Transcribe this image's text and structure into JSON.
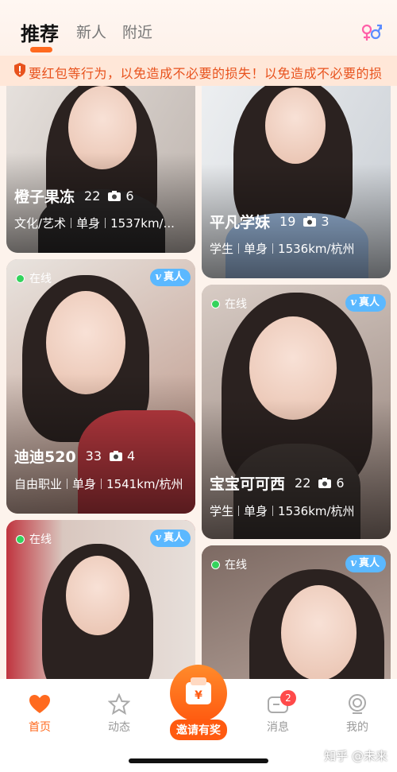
{
  "tabs": [
    {
      "label": "推荐"
    },
    {
      "label": "新人"
    },
    {
      "label": "附近"
    }
  ],
  "notice": {
    "text": "要红包等行为，以免造成不必要的损失！以免造成不必要的损"
  },
  "cards": [
    {
      "name": "橙子果冻",
      "age": "22",
      "photos": "6",
      "info": [
        "文化/艺术",
        "单身",
        "1537km/..."
      ],
      "online": "",
      "verified": ""
    },
    {
      "name": "平凡学妹",
      "age": "19",
      "photos": "3",
      "info": [
        "学生",
        "单身",
        "1536km/杭州"
      ],
      "online": "",
      "verified": ""
    },
    {
      "name": "迪迪520",
      "age": "33",
      "photos": "4",
      "info": [
        "自由职业",
        "单身",
        "1541km/杭州"
      ],
      "online": "在线",
      "verified": "真人"
    },
    {
      "name": "宝宝可可西",
      "age": "22",
      "photos": "6",
      "info": [
        "学生",
        "单身",
        "1536km/杭州"
      ],
      "online": "在线",
      "verified": "真人"
    },
    {
      "name": "",
      "age": "",
      "photos": "",
      "info": [],
      "online": "在线",
      "verified": "真人"
    },
    {
      "name": "",
      "age": "",
      "photos": "",
      "info": [],
      "online": "在线",
      "verified": "真人"
    }
  ],
  "nav": {
    "home": "首页",
    "moments": "动态",
    "invite": "邀请有奖",
    "messages": "消息",
    "messages_badge": "2",
    "me": "我的"
  },
  "watermark": "知乎 @未来",
  "colors": {
    "accent": "#ff6a1f",
    "online": "#33d35c",
    "verified": "#5bb8ff"
  },
  "icons": [
    "gender-icon",
    "warning-icon",
    "camera-icon",
    "heart-icon",
    "star-icon",
    "wallet-icon",
    "message-icon",
    "profile-icon"
  ]
}
